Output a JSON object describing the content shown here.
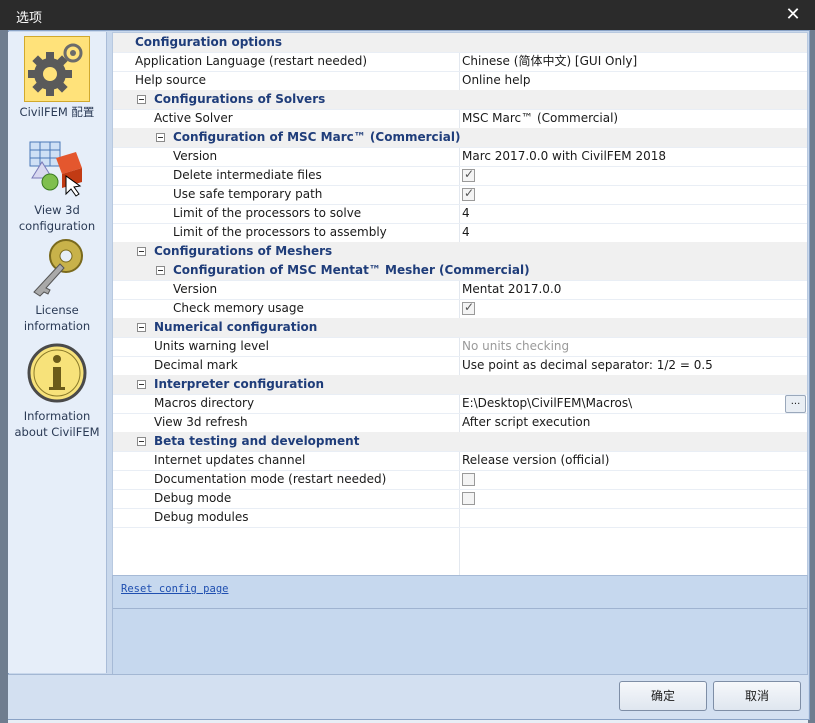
{
  "window": {
    "title": "选项"
  },
  "sidebar": {
    "items": [
      {
        "label": "CivilFEM 配置",
        "icon": "gear-icon"
      },
      {
        "label": "View 3d configuration",
        "icon": "3d-view-icon"
      },
      {
        "label": "License information",
        "icon": "key-icon"
      },
      {
        "label": "Information about CivilFEM",
        "icon": "info-icon"
      }
    ]
  },
  "grid": {
    "configuration_options": "Configuration options",
    "app_language": {
      "name": "Application Language (restart needed)",
      "value": "Chinese (简体中文) [GUI Only]"
    },
    "help_source": {
      "name": "Help source",
      "value": "Online help"
    },
    "solvers": {
      "title": "Configurations of Solvers",
      "active_solver": {
        "name": "Active Solver",
        "value": "MSC Marc™ (Commercial)"
      },
      "marc": {
        "title": "Configuration of MSC Marc™ (Commercial)",
        "version": {
          "name": "Version",
          "value": "Marc 2017.0.0 with CivilFEM 2018"
        },
        "delete_files": {
          "name": "Delete intermediate files",
          "checked": true
        },
        "safe_path": {
          "name": "Use safe temporary path",
          "checked": true
        },
        "proc_solve": {
          "name": "Limit of the processors to solve",
          "value": "4"
        },
        "proc_assembly": {
          "name": "Limit of the processors to assembly",
          "value": "4"
        }
      }
    },
    "meshers": {
      "title": "Configurations of Meshers",
      "mentat": {
        "title": "Configuration of MSC Mentat™ Mesher (Commercial)",
        "version": {
          "name": "Version",
          "value": "Mentat 2017.0.0"
        },
        "check_memory": {
          "name": "Check memory usage",
          "checked": true
        }
      }
    },
    "numerical": {
      "title": "Numerical configuration",
      "units_warning": {
        "name": "Units warning level",
        "value": "No units checking"
      },
      "decimal_mark": {
        "name": "Decimal mark",
        "value": "Use point as decimal separator: 1/2 = 0.5"
      }
    },
    "interpreter": {
      "title": "Interpreter configuration",
      "macros_dir": {
        "name": "Macros directory",
        "value": "E:\\Desktop\\CivilFEM\\Macros\\",
        "button": "..."
      },
      "view3d_refresh": {
        "name": "View 3d refresh",
        "value": "After script execution"
      }
    },
    "beta": {
      "title": "Beta testing and development",
      "updates_channel": {
        "name": "Internet updates channel",
        "value": "Release version (official)"
      },
      "doc_mode": {
        "name": "Documentation mode (restart needed)",
        "checked": false
      },
      "debug_mode": {
        "name": "Debug mode",
        "checked": false
      },
      "debug_modules": {
        "name": "Debug modules",
        "value": ""
      }
    }
  },
  "description": {
    "reset_link": "Reset config page"
  },
  "buttons": {
    "ok": "确定",
    "cancel": "取消"
  }
}
